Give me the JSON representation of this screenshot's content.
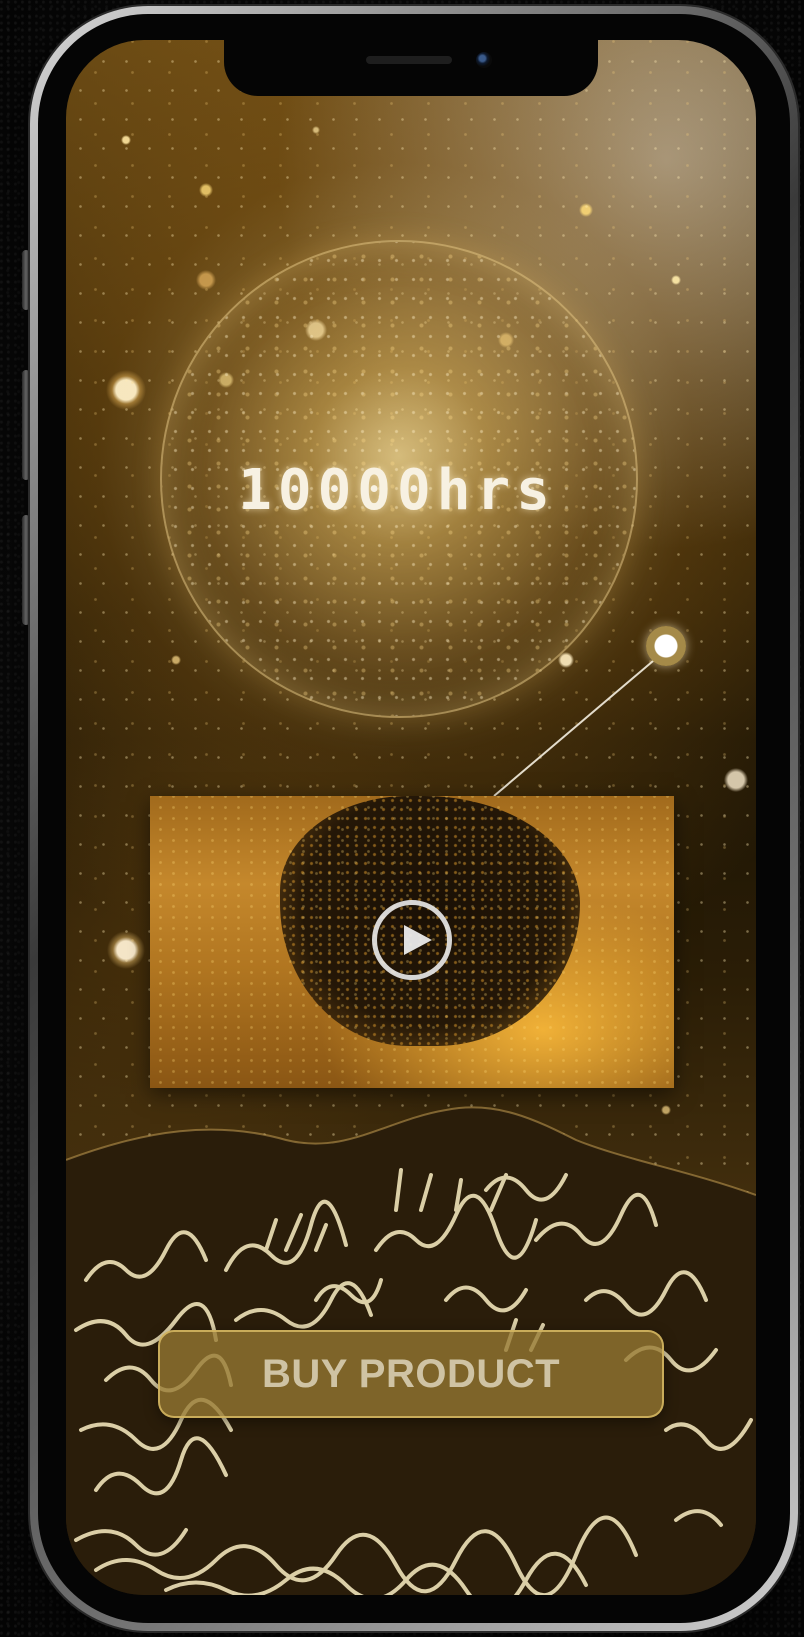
{
  "screen": {
    "headline": "10000hrs",
    "video": {
      "play_icon": "play-icon"
    },
    "cta": {
      "label": "BUY PRODUCT"
    }
  },
  "colors": {
    "accent_gold": "#a58a48",
    "button_fill": "#967832",
    "button_text": "#cfc3a4",
    "headline_text": "#f7f1e2"
  }
}
